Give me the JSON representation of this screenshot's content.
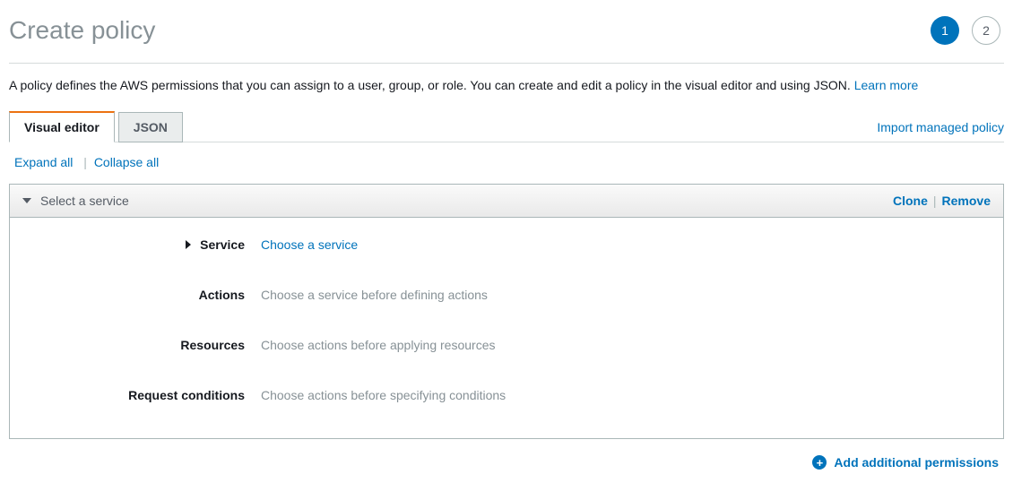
{
  "header": {
    "title": "Create policy",
    "steps": [
      "1",
      "2"
    ],
    "active_step": 0
  },
  "description": {
    "text": "A policy defines the AWS permissions that you can assign to a user, group, or role. You can create and edit a policy in the visual editor and using JSON. ",
    "learn_more": "Learn more"
  },
  "tabs": {
    "items": [
      "Visual editor",
      "JSON"
    ],
    "active": 0,
    "import_link": "Import managed policy"
  },
  "controls": {
    "expand": "Expand all",
    "collapse": "Collapse all"
  },
  "panel": {
    "title": "Select a service",
    "clone": "Clone",
    "remove": "Remove",
    "rows": [
      {
        "label": "Service",
        "value": "Choose a service",
        "is_link": true,
        "has_caret": true
      },
      {
        "label": "Actions",
        "value": "Choose a service before defining actions",
        "is_link": false,
        "has_caret": false
      },
      {
        "label": "Resources",
        "value": "Choose actions before applying resources",
        "is_link": false,
        "has_caret": false
      },
      {
        "label": "Request conditions",
        "value": "Choose actions before specifying conditions",
        "is_link": false,
        "has_caret": false
      }
    ]
  },
  "footer": {
    "add": "Add additional permissions"
  }
}
